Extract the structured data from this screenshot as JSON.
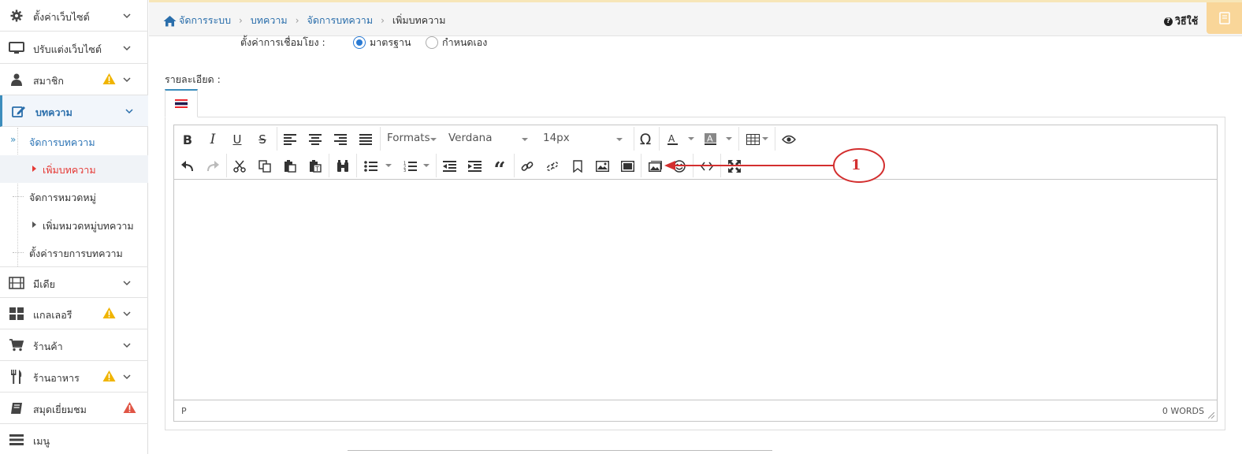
{
  "sidebar": {
    "items": [
      {
        "label": "ตั้งค่าเว็บไซต์",
        "icon": "gear-icon",
        "warn": false
      },
      {
        "label": "ปรับแต่งเว็บไซต์",
        "icon": "monitor-icon",
        "warn": false
      },
      {
        "label": "สมาชิก",
        "icon": "user-icon",
        "warn": true
      },
      {
        "label": "บทความ",
        "icon": "edit-icon",
        "warn": false,
        "active": true
      },
      {
        "label": "มีเดีย",
        "icon": "film-icon",
        "warn": false
      },
      {
        "label": "แกลเลอรี",
        "icon": "grid-icon",
        "warn": true
      },
      {
        "label": "ร้านค้า",
        "icon": "cart-icon",
        "warn": false
      },
      {
        "label": "ร้านอาหาร",
        "icon": "utensils-icon",
        "warn": true
      },
      {
        "label": "สมุดเยี่ยมชม",
        "icon": "book-icon",
        "warn": true,
        "danger": true
      },
      {
        "label": "เมนู",
        "icon": "menu-icon",
        "warn": false
      }
    ],
    "submenu": [
      {
        "label": "จัดการบทความ"
      },
      {
        "label": "เพิ่มบทความ",
        "selected": true
      },
      {
        "label": "จัดการหมวดหมู่"
      },
      {
        "label": "เพิ่มหมวดหมู่บทความ"
      },
      {
        "label": "ตั้งค่ารายการบทความ"
      }
    ]
  },
  "header": {
    "breadcrumb": [
      "จัดการระบบ",
      "บทความ",
      "จัดการบทความ",
      "เพิ่มบทความ"
    ],
    "help": "วิธีใช้"
  },
  "form": {
    "link_setting_label": "ตั้งค่าการเชื่อมโยง :",
    "radio_standard": "มาตรฐาน",
    "radio_custom": "กำหนดเอง",
    "detail_label": "รายละเอียด :"
  },
  "editor": {
    "formats": "Formats",
    "font": "Verdana",
    "size": "14px",
    "path": "P",
    "words": "0 WORDS"
  },
  "annotation": {
    "number": "1",
    "color": "#d32f2f"
  }
}
